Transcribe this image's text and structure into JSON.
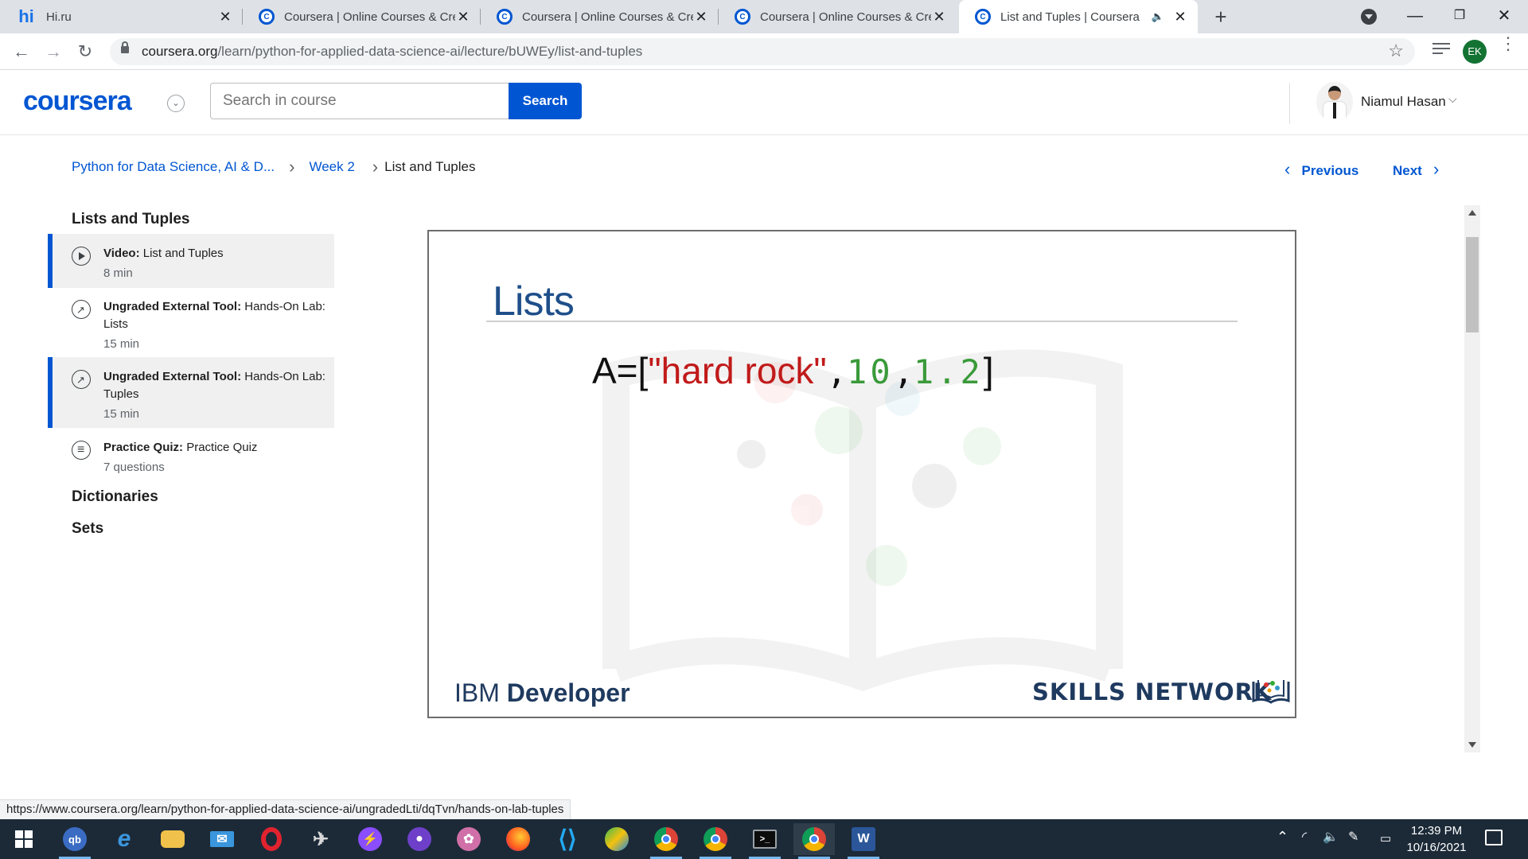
{
  "browser": {
    "tabs": [
      {
        "title": "Hi.ru",
        "favicon": "hi",
        "active": false
      },
      {
        "title": "Coursera | Online Courses & Cred",
        "favicon": "coursera",
        "active": false
      },
      {
        "title": "Coursera | Online Courses & Cred",
        "favicon": "coursera",
        "active": false
      },
      {
        "title": "Coursera | Online Courses & Cred",
        "favicon": "coursera",
        "active": false
      },
      {
        "title": "List and Tuples | Coursera",
        "favicon": "coursera",
        "active": true,
        "audio": true
      }
    ],
    "url_host": "coursera.org",
    "url_path": "/learn/python-for-applied-data-science-ai/lecture/bUWEy/list-and-tuples",
    "profile_initials": "EK"
  },
  "header": {
    "logo": "coursera",
    "search_placeholder": "Search in course",
    "search_button": "Search",
    "user_name": "Niamul Hasan"
  },
  "breadcrumb": {
    "course": "Python for Data Science, AI & D...",
    "week": "Week 2",
    "current": "List and Tuples"
  },
  "nav": {
    "previous": "Previous",
    "next": "Next"
  },
  "sidebar": {
    "section_title": "Lists and Tuples",
    "items": [
      {
        "type": "Video:",
        "name": "List and Tuples",
        "meta": "8 min",
        "icon": "play-icon",
        "selected": true
      },
      {
        "type": "Ungraded External Tool:",
        "name": "Hands-On Lab: Lists",
        "meta": "15 min",
        "icon": "external-tool-icon",
        "selected": false
      },
      {
        "type": "Ungraded External Tool:",
        "name": "Hands-On Lab: Tuples",
        "meta": "15 min",
        "icon": "external-tool-icon",
        "selected": true
      },
      {
        "type": "Practice Quiz:",
        "name": "Practice Quiz",
        "meta": "7 questions",
        "icon": "quiz-icon",
        "selected": false
      }
    ],
    "sections": [
      "Dictionaries",
      "Sets"
    ]
  },
  "slide": {
    "title": "Lists",
    "code_prefix": "A=[",
    "code_string": "\"hard rock\"",
    "code_sep1": ",",
    "code_num1": "10",
    "code_sep2": ",",
    "code_num2": "1.2",
    "code_suffix": "]",
    "footer_left_light": "IBM ",
    "footer_left_bold": "Developer",
    "footer_right": "SKILLS NETWORK"
  },
  "status_url": "https://www.coursera.org/learn/python-for-applied-data-science-ai/ungradedLti/dqTvn/hands-on-lab-tuples",
  "taskbar": {
    "time": "12:39 PM",
    "date": "10/16/2021",
    "apps": [
      "qbittorrent",
      "edge",
      "file-explorer",
      "mail",
      "opera",
      "app-6",
      "messenger",
      "github-desktop",
      "app-9",
      "firefox",
      "vscode",
      "app-12",
      "chrome",
      "chrome-profile",
      "terminal",
      "chrome-ek",
      "word"
    ]
  },
  "colors": {
    "accent": "#0056d2",
    "slide_title": "#1f4f8a",
    "code_string": "#c11a1a",
    "code_number": "#3a9a3a"
  }
}
